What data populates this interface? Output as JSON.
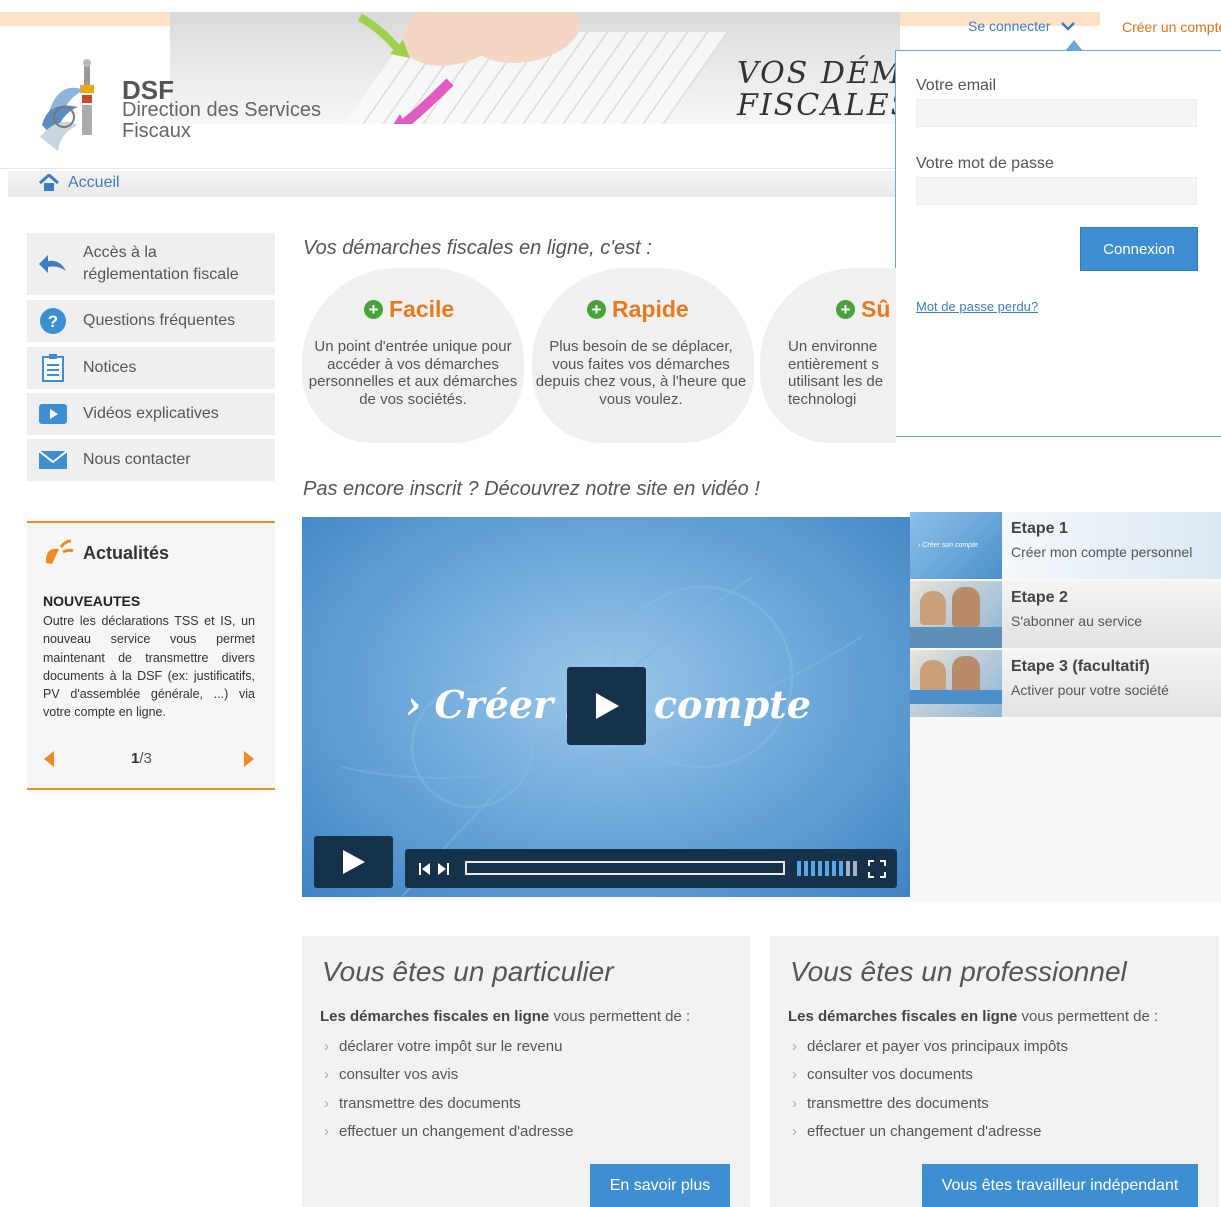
{
  "header": {
    "logo_title": "DSF",
    "logo_subtitle_1": "Direction des Services",
    "logo_subtitle_2": "Fiscaux",
    "slogan_line1": "VOS DÉMA",
    "slogan_line2": "FISCALES E",
    "login_tab": "Se connecter",
    "create_tab": "Créer un compte"
  },
  "breadcrumb": {
    "home": "Accueil"
  },
  "login": {
    "email_label": "Votre email",
    "email_value": "",
    "password_label": "Votre mot de passe",
    "password_value": "",
    "submit": "Connexion",
    "lost_password": "Mot de passe perdu?"
  },
  "sidebar": {
    "items": [
      {
        "label_1": "Accès à la",
        "label_2": "réglementation fiscale",
        "icon": "back-arrow-icon"
      },
      {
        "label": "Questions fréquentes",
        "icon": "question-icon"
      },
      {
        "label": "Notices",
        "icon": "clipboard-icon"
      },
      {
        "label": "Vidéos explicatives",
        "icon": "video-icon"
      },
      {
        "label": "Nous contacter",
        "icon": "envelope-icon"
      }
    ]
  },
  "news": {
    "title": "Actualités",
    "heading": "NOUVEAUTES",
    "text": "Outre les déclarations TSS et IS, un nouveau service vous permet maintenant de transmettre divers documents à la DSF (ex: justificatifs, PV d'assemblée générale, ...) via votre compte en ligne.",
    "page_current": "1",
    "page_total": "/3"
  },
  "intro": {
    "title": "Vos démarches fiscales en ligne, c'est :",
    "features": [
      {
        "title": "Facile",
        "text": "Un point d'entrée unique pour accéder à vos démarches personnelles et aux démarches de vos sociétés."
      },
      {
        "title": "Rapide",
        "text": "Plus besoin de se déplacer, vous faites vos démarches depuis chez vous, à l'heure que vous voulez."
      },
      {
        "title": "Sû",
        "text": "Un environne entièrement s utilisant les de technologi"
      }
    ]
  },
  "video": {
    "title": "Pas encore inscrit ? Découvrez notre site en vidéo !",
    "overlay_text": "› Créer son compte",
    "progress": 0
  },
  "steps": [
    {
      "title": "Etape 1",
      "subtitle": "Créer mon compte personnel",
      "thumb_caption": "› Créer son compte"
    },
    {
      "title": "Etape 2",
      "subtitle": "S'abonner au service"
    },
    {
      "title": "Etape 3 (facultatif)",
      "subtitle": "Activer pour votre société"
    }
  ],
  "cards": {
    "particulier": {
      "title": "Vous êtes un particulier",
      "intro_bold": "Les démarches fiscales en ligne",
      "intro_rest": " vous permettent de :",
      "items": [
        "déclarer votre impôt sur le revenu",
        "consulter vos avis",
        "transmettre des documents",
        "effectuer un changement d'adresse"
      ],
      "button": "En savoir plus"
    },
    "professionnel": {
      "title": "Vous êtes un professionnel",
      "intro_bold": "Les démarches fiscales en ligne",
      "intro_rest": " vous permettent de :",
      "items": [
        "déclarer et payer vos principaux impôts",
        "consulter vos documents",
        "transmettre des documents",
        "effectuer un changement d'adresse"
      ],
      "button": "Vous êtes travailleur indépendant"
    }
  },
  "colors": {
    "accent_orange": "#e77a1f",
    "accent_blue": "#3d8fd1",
    "green_plus": "#4aa23a",
    "video_dark": "#16324a"
  }
}
